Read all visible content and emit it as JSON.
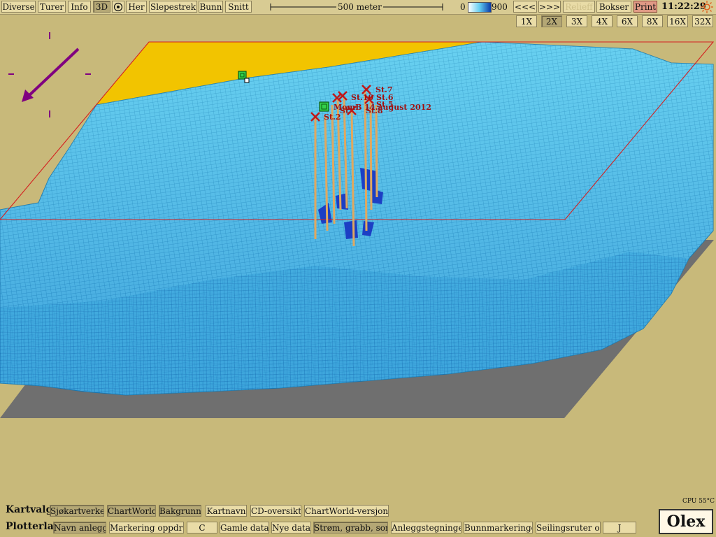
{
  "toolbar": {
    "diverse": "Diverse",
    "turer": "Turer",
    "info": "Info",
    "three_d": "3D",
    "her": "Her",
    "slepestrek": "Slepestrek",
    "bunn": "Bunn",
    "snitt": "Snitt",
    "scale": "500 meter",
    "depth_min": "0",
    "depth_max": "900",
    "prev": "<<<",
    "next": ">>>",
    "relieff": "Relieff",
    "bokser": "Bokser",
    "print": "Print",
    "clock": "11:22:29"
  },
  "zoom": [
    "1X",
    "2X",
    "3X",
    "4X",
    "6X",
    "8X",
    "16X",
    "32X"
  ],
  "zoom_selected": "2X",
  "map_labels": {
    "st7": "St.7",
    "st6": "St.6",
    "st5": "St.5",
    "st10": "St.10",
    "st2": "St.2",
    "st8": "St.8",
    "st_other": "St",
    "survey": "MomB 14.august 2012"
  },
  "kartvalg": {
    "title": "Kartvalg",
    "items": [
      "Sjøkartverket",
      "ChartWorld",
      "Bakgrunn",
      "Kartnavn",
      "CD-oversikt",
      "ChartWorld-versjoner"
    ]
  },
  "plotterlag": {
    "title": "Plotterlag",
    "items": [
      "Navn anlegg",
      "Markering oppdrett",
      "C",
      "Gamle data",
      "Nye data",
      "Strøm, grabb, sonde",
      "Anleggstegninger",
      "Bunnmarkeringer",
      "Seilingsruter o.l.",
      "J"
    ]
  },
  "cpu": "CPU 55°C",
  "logo": "Olex",
  "colors": {
    "background": "#c8b97a",
    "terrain": "#5cc8ec",
    "land": "#f2c400",
    "plane_outline": "#d42020",
    "marker": "#c01818",
    "compass": "#800080"
  }
}
